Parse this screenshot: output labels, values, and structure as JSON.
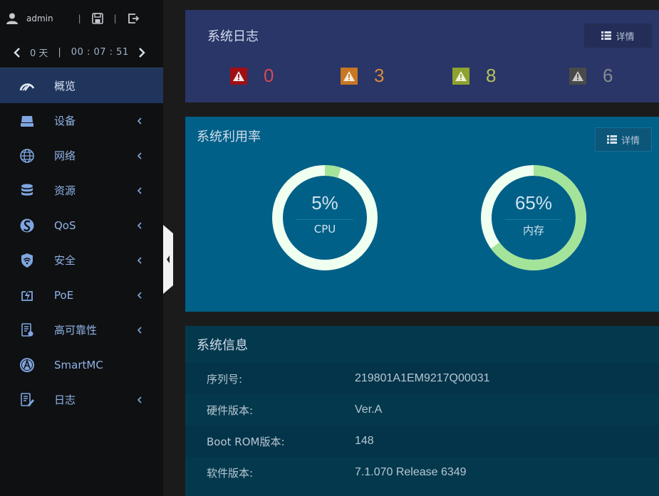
{
  "user": {
    "name": "admin",
    "sep1": "|",
    "sep2": "|"
  },
  "uptime": {
    "days": "0 天",
    "bar": "|",
    "clock": "00 : 07 : 51"
  },
  "nav": [
    {
      "label": "概览",
      "icon": "speedometer-icon",
      "active": true,
      "chevron": false
    },
    {
      "label": "设备",
      "icon": "device-icon",
      "chevron": true
    },
    {
      "label": "网络",
      "icon": "globe-icon",
      "chevron": true
    },
    {
      "label": "资源",
      "icon": "database-icon",
      "chevron": true
    },
    {
      "label": "QoS",
      "icon": "qos-icon",
      "chevron": true
    },
    {
      "label": "安全",
      "icon": "shield-wifi-icon",
      "chevron": true
    },
    {
      "label": "PoE",
      "icon": "poe-icon",
      "chevron": true
    },
    {
      "label": "高可靠性",
      "icon": "reliability-icon",
      "chevron": true
    },
    {
      "label": "SmartMC",
      "icon": "smartmc-icon",
      "chevron": false
    },
    {
      "label": "日志",
      "icon": "log-icon",
      "chevron": true
    }
  ],
  "log_panel": {
    "title": "系统日志",
    "detail_label": "详情",
    "alarms": [
      {
        "level": "critical",
        "count": "0",
        "bg": "#a00f14",
        "color": "#d24a52"
      },
      {
        "level": "major",
        "count": "3",
        "bg": "#c87722",
        "color": "#d78a3a"
      },
      {
        "level": "minor",
        "count": "8",
        "bg": "#8da22f",
        "color": "#b3c35a"
      },
      {
        "level": "warning",
        "count": "6",
        "bg": "#4a4a4a",
        "color": "#8a8a8a"
      }
    ]
  },
  "usage_panel": {
    "title": "系统利用率",
    "detail_label": "详情",
    "gauges": [
      {
        "name": "cpu",
        "percent_text": "5%",
        "label": "CPU",
        "value": 5
      },
      {
        "name": "memory",
        "percent_text": "65%",
        "label": "内存",
        "value": 65
      }
    ],
    "colors": {
      "track": "#effff0",
      "fill": "#a4e49a"
    }
  },
  "info_panel": {
    "title": "系统信息",
    "rows": [
      {
        "key": "序列号:",
        "value": "219801A1EM9217Q00031"
      },
      {
        "key": "硬件版本:",
        "value": "Ver.A"
      },
      {
        "key": "Boot ROM版本:",
        "value": "148"
      },
      {
        "key": "软件版本:",
        "value": "7.1.070 Release 6349"
      }
    ]
  }
}
